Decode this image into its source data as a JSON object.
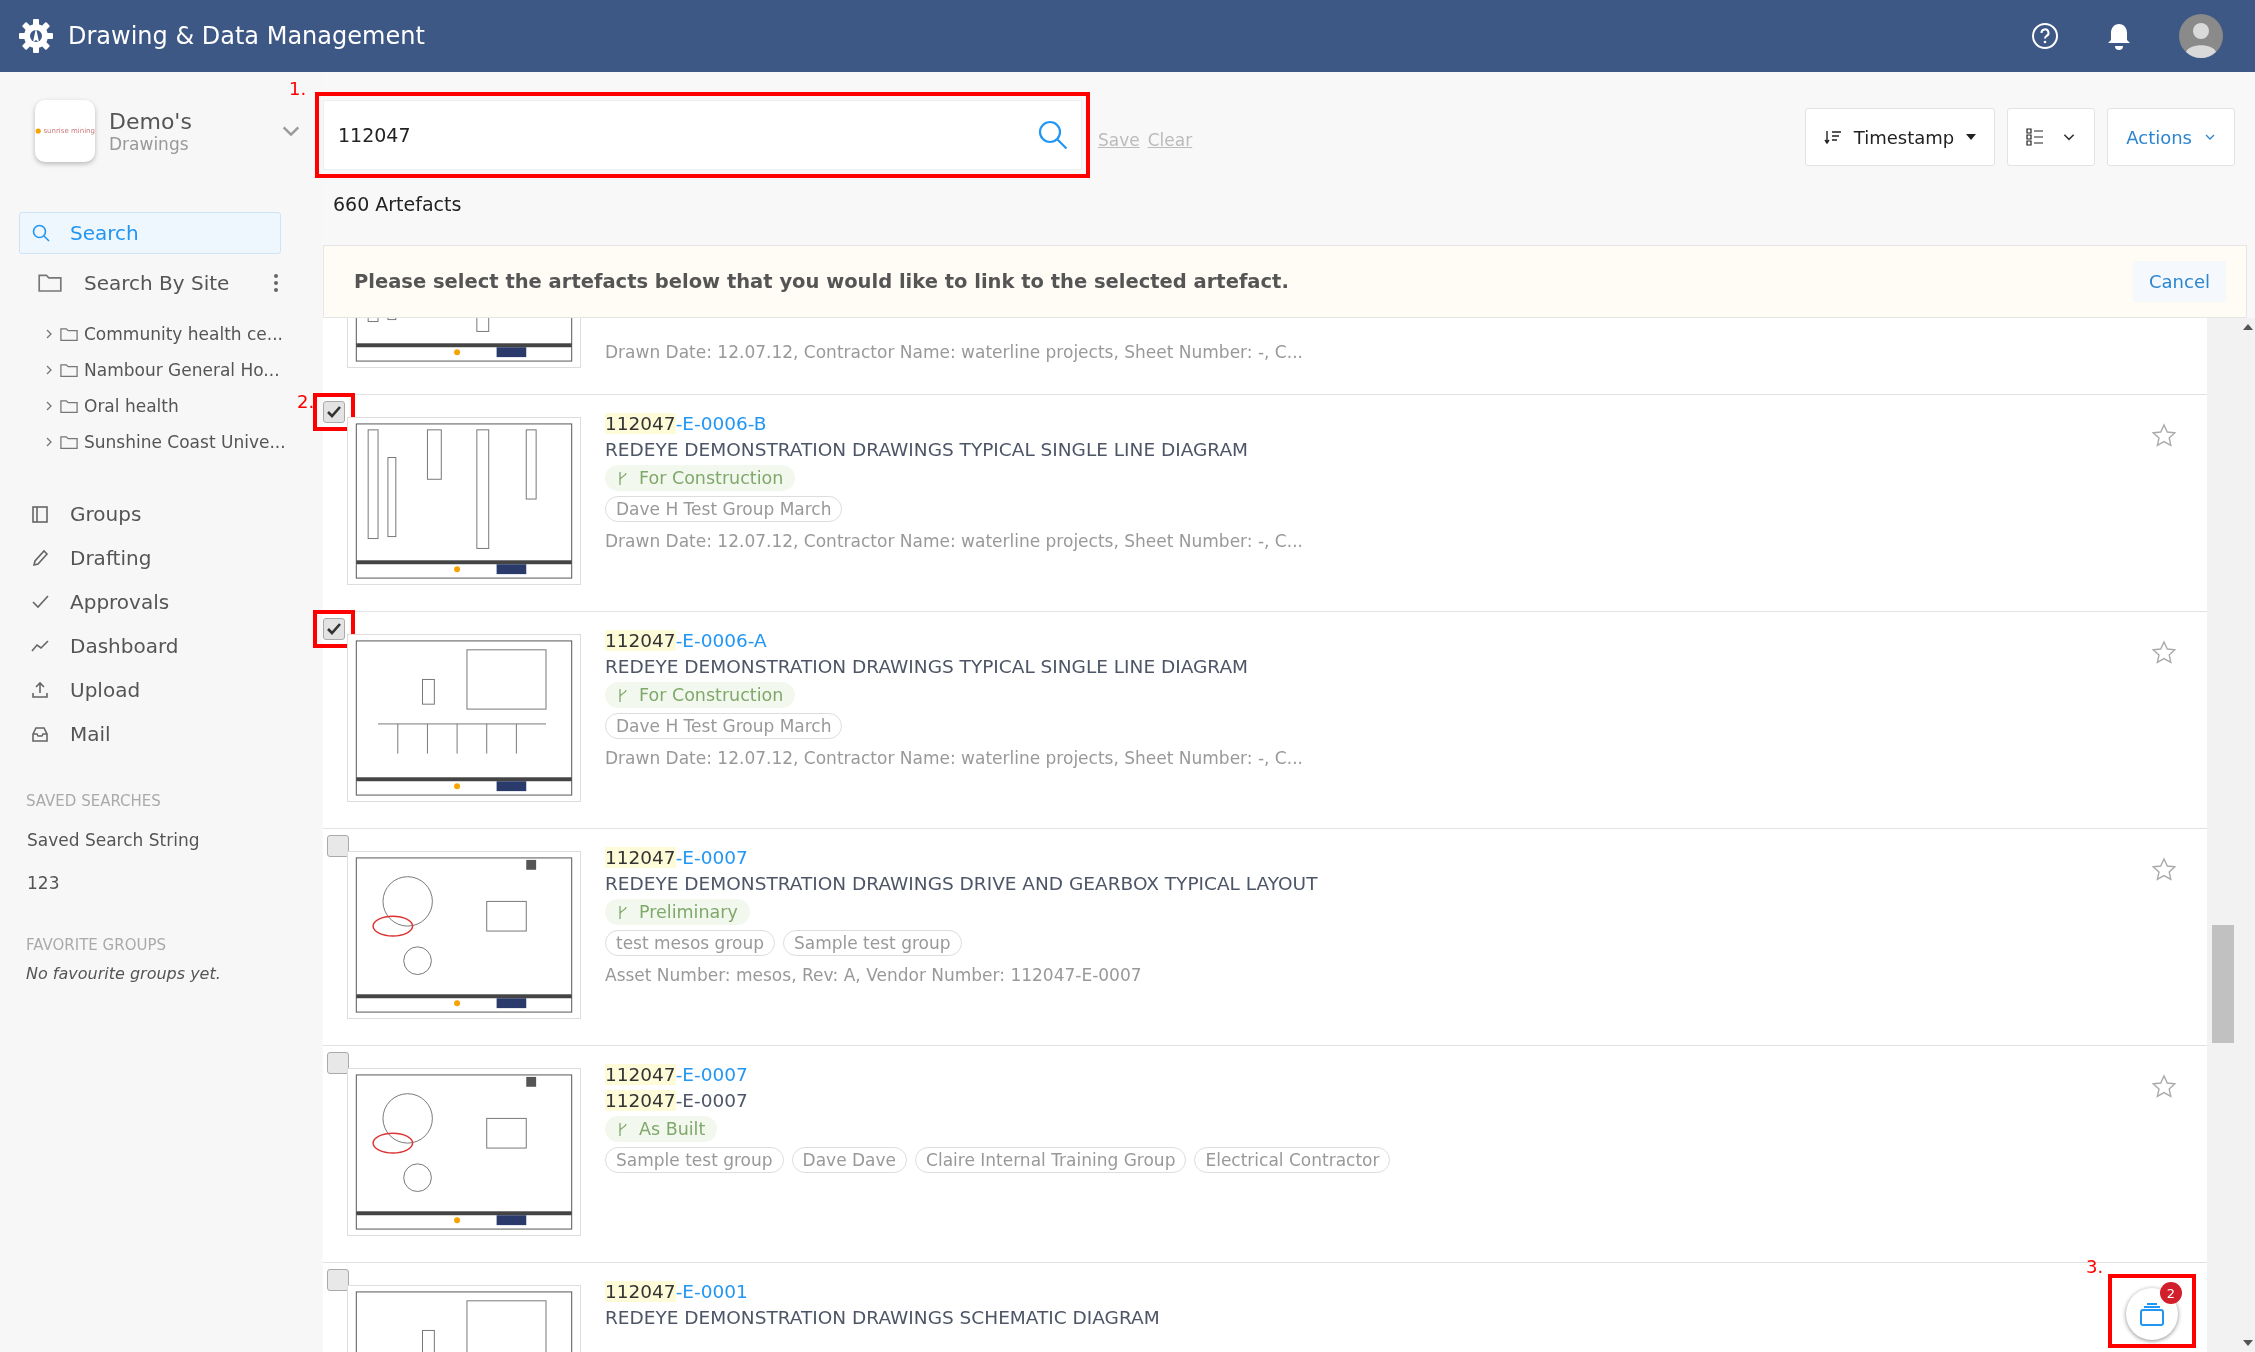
{
  "header": {
    "title": "Drawing & Data Management"
  },
  "sidebar": {
    "workspace": {
      "logo_text": "sunrise mining",
      "name": "Demo's",
      "subtitle": "Drawings"
    },
    "search_item": {
      "label": "Search",
      "selected": true
    },
    "site_search": {
      "label": "Search By Site"
    },
    "sites": [
      {
        "label": "Community health ce..."
      },
      {
        "label": "Nambour General Ho..."
      },
      {
        "label": "Oral health"
      },
      {
        "label": "Sunshine Coast Unive..."
      }
    ],
    "nav": [
      {
        "kind": "groups",
        "label": "Groups"
      },
      {
        "kind": "drafting",
        "label": "Drafting"
      },
      {
        "kind": "approvals",
        "label": "Approvals"
      },
      {
        "kind": "dashboard",
        "label": "Dashboard"
      },
      {
        "kind": "upload",
        "label": "Upload"
      },
      {
        "kind": "mail",
        "label": "Mail"
      }
    ],
    "saved_searches": {
      "heading": "SAVED SEARCHES",
      "items": [
        "Saved Search String",
        "123"
      ]
    },
    "favorite_groups": {
      "heading": "FAVORITE GROUPS",
      "empty": "No favourite groups yet."
    }
  },
  "search": {
    "value": "112047",
    "annotation": "1.",
    "save": "Save",
    "clear": "Clear"
  },
  "result_count": "660 Artefacts",
  "toolbar": {
    "sort": "Timestamp",
    "actions": "Actions"
  },
  "banner": {
    "message": "Please select the artefacts below that you would like to link to the selected artefact.",
    "cancel": "Cancel"
  },
  "rows": [
    {
      "kind": "partial",
      "meta": "Drawn Date: 12.07.12, Contractor Name: waterline projects, Sheet Number: -, C..."
    },
    {
      "kind": "full",
      "checked": true,
      "annotated": true,
      "annotation": "2.",
      "id_match": "112047",
      "id_rest": "-E-0006-B",
      "title": "REDEYE DEMONSTRATION DRAWINGS TYPICAL SINGLE LINE DIAGRAM",
      "status": "For Construction",
      "tags": [
        "Dave H Test Group March"
      ],
      "meta": "Drawn Date: 12.07.12, Contractor Name: waterline projects, Sheet Number: -, C...",
      "starred": false
    },
    {
      "kind": "full",
      "checked": true,
      "annotated": true,
      "id_match": "112047",
      "id_rest": "-E-0006-A",
      "title": "REDEYE DEMONSTRATION DRAWINGS TYPICAL SINGLE LINE DIAGRAM",
      "status": "For Construction",
      "tags": [
        "Dave H Test Group March"
      ],
      "meta": "Drawn Date: 12.07.12, Contractor Name: waterline projects, Sheet Number: -, C...",
      "starred": false
    },
    {
      "kind": "full",
      "checked": false,
      "annotated": false,
      "id_match": "112047",
      "id_rest": "-E-0007",
      "title": "REDEYE DEMONSTRATION DRAWINGS DRIVE AND GEARBOX TYPICAL LAYOUT",
      "status": "Preliminary",
      "tags": [
        "test mesos group",
        "Sample test group"
      ],
      "meta": "Asset Number: mesos, Rev: A, Vendor Number: 112047-E-0007",
      "starred": false
    },
    {
      "kind": "full",
      "checked": false,
      "annotated": false,
      "id_match": "112047",
      "id_rest": "-E-0007",
      "title_match": "112047",
      "title": "-E-0007",
      "status": "As Built",
      "tags": [
        "Sample test group",
        "Dave Dave",
        "Claire Internal Training Group",
        "Electrical Contractor"
      ],
      "starred": false
    },
    {
      "kind": "full",
      "checked": false,
      "annotated": false,
      "id_match": "112047",
      "id_rest": "-E-0001",
      "title": "REDEYE DEMONSTRATION DRAWINGS SCHEMATIC DIAGRAM"
    }
  ],
  "fab": {
    "count": "2",
    "annotation": "3."
  }
}
